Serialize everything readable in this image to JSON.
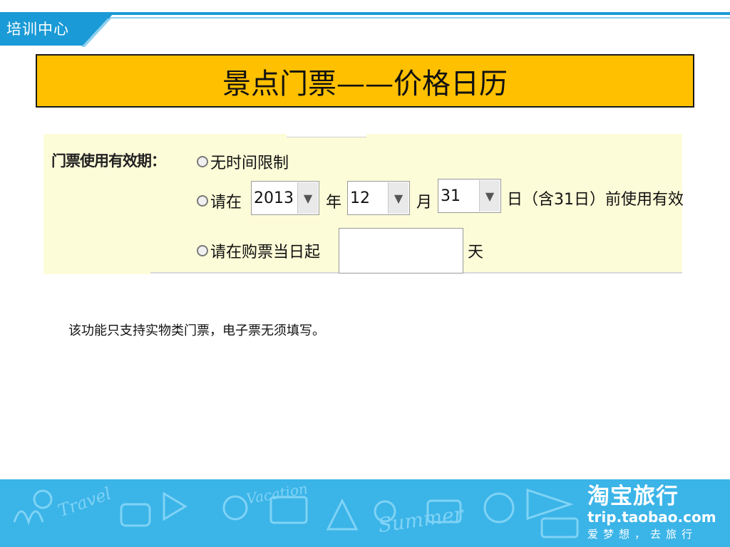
{
  "header": {
    "section_title": "培训中心"
  },
  "slide": {
    "title": "景点门票——价格日历"
  },
  "validity_form": {
    "label": "门票使用有效期：",
    "option_no_limit": "无时间限制",
    "option_before_date_prefix": "请在",
    "year_value": "2013",
    "year_unit": "年",
    "month_value": "12",
    "month_unit": "月",
    "day_value": "31",
    "day_suffix": "日（含31日）前使用有效",
    "option_days_prefix": "请在购票当日起",
    "days_value": "",
    "days_unit": "天",
    "dropdown_arrow": "▼"
  },
  "note": "该功能只支持实物类门票，电子票无须填写。",
  "footer": {
    "brand_name": "淘宝旅行",
    "brand_url": "trip.taobao.com",
    "slogan": "爱梦想，去旅行",
    "decor_words": [
      "Travel",
      "Vacation",
      "Summer"
    ]
  },
  "colors": {
    "header_blue": "#1a9ad6",
    "title_box": "#ffc000",
    "panel_bg": "#fdfcd8",
    "footer_blue": "#3bb4e8"
  }
}
